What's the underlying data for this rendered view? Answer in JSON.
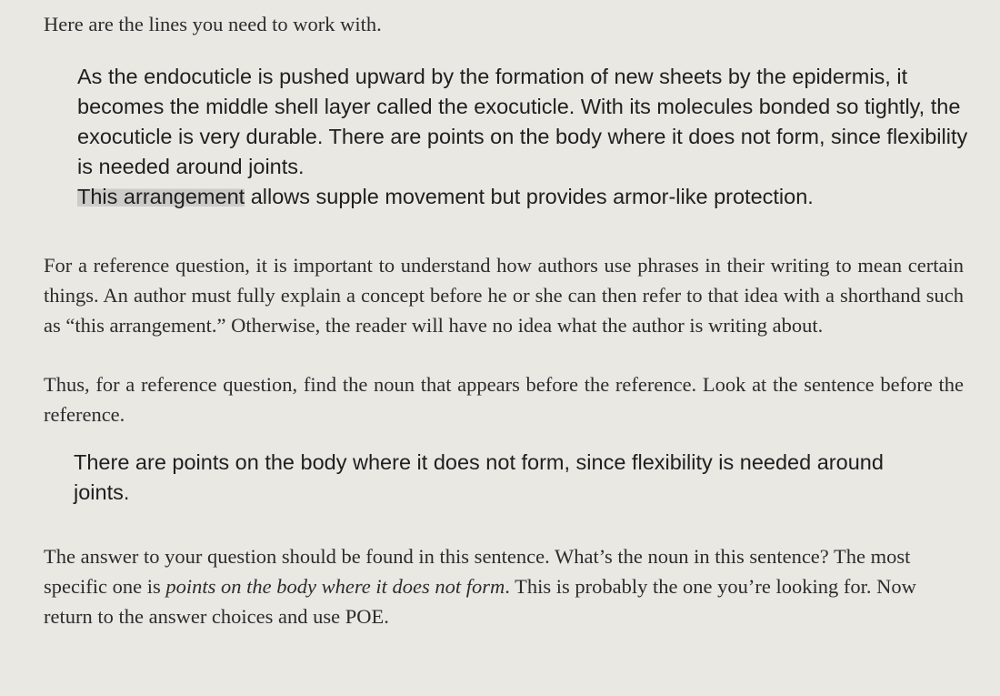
{
  "intro": "Here are the lines you need to work with.",
  "passage": {
    "lead": "As the endocuticle is pushed upward by the formation of new sheets by the epidermis, it becomes the middle shell layer called the exocuticle. With its molecules bonded so tightly, the exocuticle is very durable. There are points on the body where it does not form, since flexibility is needed around joints.",
    "highlighted": "This arrangement",
    "tail": "allows supple movement but provides armor-like protection."
  },
  "reference_paragraph": "For a reference question, it is important to understand how authors use phrases in their writing to mean certain things. An author must fully explain a concept before he or she can then refer to that idea with a shorthand such as “this arrangement.” Otherwise, the reader will have no idea what the author is writing about.",
  "thus_paragraph": "Thus, for a reference question, find the noun that appears before the reference. Look at the sentence before the reference.",
  "quoted_sentence": "There are points on the body where it does not form, since flexibility is needed around joints.",
  "answer_paragraph": {
    "part1": "The answer to your question should be found in this sentence. What’s the noun in this sentence? The most specific one is",
    "emphasis": "points on the body where it does not form",
    "part2": ". This is probably the one you’re looking for. Now return to the answer choices and use POE."
  }
}
